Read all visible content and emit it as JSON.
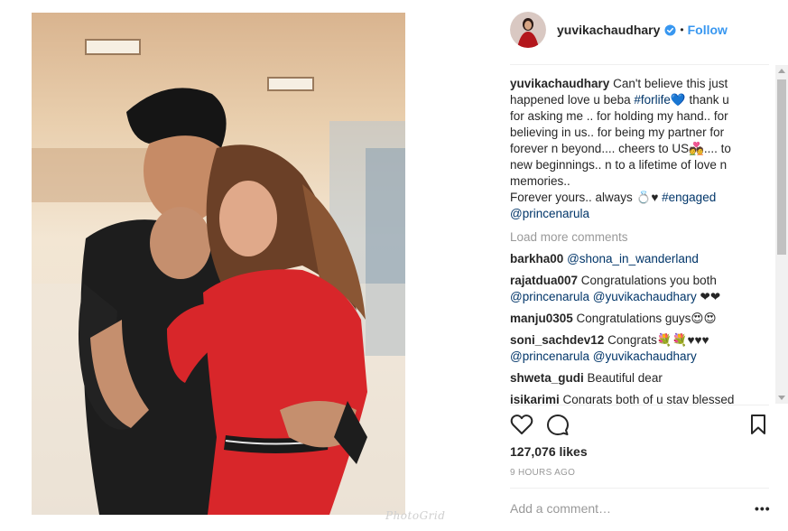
{
  "header": {
    "username": "yuvikachaudhary",
    "separator": "•",
    "follow_label": "Follow"
  },
  "caption": {
    "username": "yuvikachaudhary",
    "text_1": " Can't believe this just happened love u beba ",
    "hashtag_forlife": "#forlife",
    "emoji_heart": "💙",
    "text_2": " thank u for asking me .. for holding my hand.. for believing in us.. for being my partner for forever n beyond.... cheers to US",
    "emoji_couple": "💑",
    "text_3": ".... to new beginnings.. n to a lifetime of love n memories..",
    "text_4": "Forever yours.. always ",
    "emoji_ring": "💍",
    "emoji_black_heart": "♥",
    "hashtag_engaged": "#engaged",
    "mention": "@princenarula"
  },
  "load_more": "Load more comments",
  "comments": [
    {
      "user": "barkha00",
      "parts": [
        {
          "t": " "
        },
        {
          "t": "@shona_in_wanderland",
          "link": true
        }
      ]
    },
    {
      "user": "rajatdua007",
      "parts": [
        {
          "t": " Congratulations you both "
        },
        {
          "t": "@princenarula",
          "link": true
        },
        {
          "t": " "
        },
        {
          "t": "@yuvikachaudhary",
          "link": true
        },
        {
          "t": " ❤❤"
        }
      ]
    },
    {
      "user": "manju0305",
      "parts": [
        {
          "t": " Congratulations guys😍😍"
        }
      ]
    },
    {
      "user": "soni_sachdev12",
      "parts": [
        {
          "t": " Congrats💐💐♥♥♥ "
        },
        {
          "t": "@princenarula",
          "link": true
        },
        {
          "t": " "
        },
        {
          "t": "@yuvikachaudhary",
          "link": true
        }
      ]
    },
    {
      "user": "shweta_gudi",
      "parts": [
        {
          "t": " Beautiful dear"
        }
      ]
    },
    {
      "user": "isikarimi",
      "parts": [
        {
          "t": " Congrats both of u stay blessed"
        }
      ]
    }
  ],
  "likes": "127,076 likes",
  "timestamp": "9 HOURS AGO",
  "add_comment_placeholder": "Add a comment…",
  "more_label": "•••",
  "watermark": "PhotoGrid",
  "colors": {
    "link": "#003569",
    "follow": "#3897f0",
    "muted": "#999999",
    "verified": "#3897f0"
  }
}
